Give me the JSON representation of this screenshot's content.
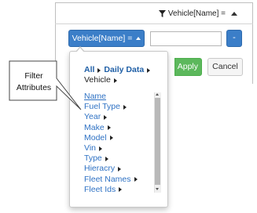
{
  "header": {
    "filter_summary": "Vehicle[Name] ="
  },
  "toolbar": {
    "dropdown_label": "Vehicle[Name] =",
    "value_input": "",
    "minus_label": "-",
    "apply_label": "Apply",
    "cancel_label": "Cancel"
  },
  "menu": {
    "breadcrumb": {
      "all": "All",
      "daily_data": "Daily Data",
      "vehicle": "Vehicle"
    },
    "items": [
      {
        "label": "Name"
      },
      {
        "label": "Fuel Type"
      },
      {
        "label": "Year"
      },
      {
        "label": "Make"
      },
      {
        "label": "Model"
      },
      {
        "label": "Vin"
      },
      {
        "label": "Type"
      },
      {
        "label": "Hieracry"
      },
      {
        "label": "Fleet Names"
      },
      {
        "label": "Fleet Ids"
      }
    ]
  },
  "callout": {
    "line1": "Filter",
    "line2": "Attributes"
  },
  "colors": {
    "primary_blue": "#3b7ec8",
    "apply_green": "#5cb85c",
    "link_blue": "#2f72c4"
  }
}
